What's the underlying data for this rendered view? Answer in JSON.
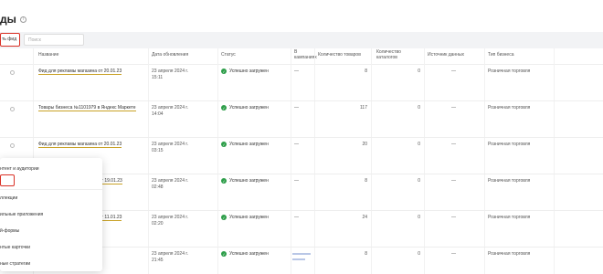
{
  "page": {
    "title": "ды",
    "info_icon": "info-circle-icon"
  },
  "toolbar": {
    "create_label": "ть фид",
    "search_placeholder": "Поиск"
  },
  "columns": {
    "name": "Название",
    "updated": "Дата обновления",
    "status": "Статус",
    "campaigns_1": "В",
    "campaigns_2": "кампаниях",
    "products": "Количество товаров",
    "catalogs_1": "Количество",
    "catalogs_2": "каталогов",
    "source": "Источник данных",
    "business": "Тип бизнеса"
  },
  "rows": [
    {
      "name": "Фид для рекламы магазина от 20.01.23",
      "updated_1": "23 апреля 2024 г.",
      "updated_2": "15:11",
      "status": "Успешно загружен",
      "campaigns": "—",
      "products": "8",
      "catalogs": "0",
      "source": "—",
      "business": "Розничная торговля"
    },
    {
      "name": "Товары бизнеса №1101979 в Яндекс Маркете",
      "updated_1": "23 апреля 2024 г.",
      "updated_2": "14:04",
      "status": "Успешно загружен",
      "campaigns": "—",
      "products": "117",
      "catalogs": "0",
      "source": "—",
      "business": "Розничная торговля"
    },
    {
      "name": "Фид для рекламы магазина от 20.01.23",
      "updated_1": "23 апреля 2024 г.",
      "updated_2": "03:15",
      "status": "Успешно загружен",
      "campaigns": "—",
      "products": "20",
      "catalogs": "0",
      "source": "—",
      "business": "Розничная торговля"
    },
    {
      "name": "от 19.01.23",
      "updated_1": "23 апреля 2024 г.",
      "updated_2": "02:48",
      "status": "Успешно загружен",
      "campaigns": "—",
      "products": "8",
      "catalogs": "0",
      "source": "—",
      "business": "Розничная торговля"
    },
    {
      "name": "от 11.01.23",
      "updated_1": "23 апреля 2024 г.",
      "updated_2": "02:20",
      "status": "Успешно загружен",
      "campaigns": "—",
      "products": "24",
      "catalogs": "0",
      "source": "—",
      "business": "Розничная торговля"
    },
    {
      "name": "",
      "updated_1": "23 апреля 2024 г.",
      "updated_2": "21:45",
      "status": "Успешно загружен",
      "campaigns": "",
      "products": "8",
      "catalogs": "0",
      "source": "—",
      "business": "Розничная торговля"
    }
  ],
  "dropdown": {
    "items": [
      "нтент и аудитории",
      "",
      "ллекции",
      "ильные приложения",
      "й-формы",
      "нтые карточки",
      "ные стратегии"
    ]
  },
  "colors": {
    "accent_red": "#d93025",
    "status_green": "#2e9e4a",
    "link_underline": "#c9a227"
  }
}
